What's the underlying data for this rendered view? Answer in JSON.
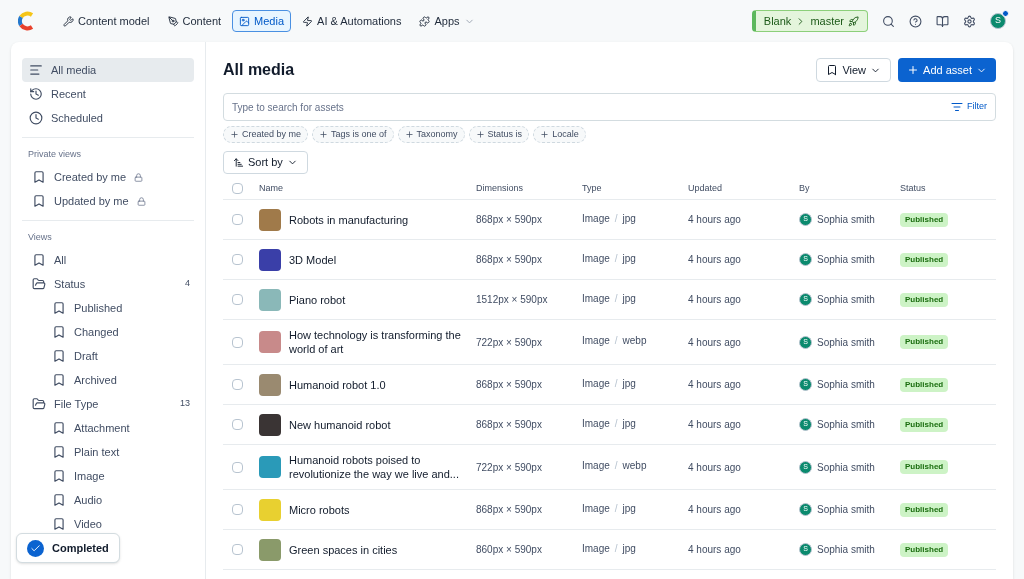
{
  "topbar": {
    "nav": [
      {
        "label": "Content model",
        "selected": false,
        "dropdown": false
      },
      {
        "label": "Content",
        "selected": false,
        "dropdown": false
      },
      {
        "label": "Media",
        "selected": true,
        "dropdown": false
      },
      {
        "label": "AI & Automations",
        "selected": false,
        "dropdown": false
      },
      {
        "label": "Apps",
        "selected": false,
        "dropdown": true
      }
    ],
    "environment": {
      "space": "Blank",
      "branch": "master"
    },
    "user": {
      "initial": "S",
      "notification": true
    }
  },
  "sidebar": {
    "top": [
      {
        "label": "All media",
        "selected": true
      },
      {
        "label": "Recent",
        "selected": false
      },
      {
        "label": "Scheduled",
        "selected": false
      }
    ],
    "sections": [
      {
        "title": "Private views",
        "items": [
          {
            "label": "Created by me",
            "locked": true,
            "selected": false
          },
          {
            "label": "Updated by me",
            "locked": true,
            "selected": false
          }
        ]
      },
      {
        "title": "Views",
        "items": [
          {
            "label": "All",
            "selected": false
          },
          {
            "label": "Status",
            "count": "4",
            "folder": true,
            "selected": false,
            "children": [
              {
                "label": "Published",
                "selected": false
              },
              {
                "label": "Changed",
                "selected": false
              },
              {
                "label": "Draft",
                "selected": false
              },
              {
                "label": "Archived",
                "selected": false
              }
            ]
          },
          {
            "label": "File Type",
            "count": "13",
            "folder": true,
            "selected": false,
            "children": [
              {
                "label": "Attachment",
                "selected": false
              },
              {
                "label": "Plain text",
                "selected": false
              },
              {
                "label": "Image",
                "selected": false
              },
              {
                "label": "Audio",
                "selected": false
              },
              {
                "label": "Video",
                "selected": false
              }
            ]
          }
        ]
      }
    ]
  },
  "toast": {
    "text": "Completed"
  },
  "main": {
    "title": "All media",
    "view_button": "View",
    "add_button": "Add asset",
    "search": {
      "placeholder": "Type to search for assets",
      "filter": "Filter"
    },
    "filter_chips": [
      "Created by me",
      "Tags is one of",
      "Taxonomy",
      "Status is",
      "Locale"
    ],
    "sort_button": "Sort by",
    "table": {
      "select_all_checked": false,
      "columns": [
        "Name",
        "Dimensions",
        "Type",
        "Updated",
        "By",
        "Status"
      ],
      "rows": [
        {
          "name": "Robots in manufacturing",
          "separator": "/",
          "dimensions": "868px × 590px",
          "type": "Image",
          "format": "jpg",
          "updated": "4 hours ago",
          "by": "Sophia smith",
          "avatar": "S",
          "status": "Published",
          "checked": false
        },
        {
          "name": "3D Model",
          "separator": "/",
          "dimensions": "868px × 590px",
          "type": "Image",
          "format": "jpg",
          "updated": "4 hours ago",
          "by": "Sophia smith",
          "avatar": "S",
          "status": "Published",
          "checked": false
        },
        {
          "name": "Piano robot",
          "separator": "/",
          "dimensions": "1512px × 590px",
          "type": "Image",
          "format": "jpg",
          "updated": "4 hours ago",
          "by": "Sophia smith",
          "avatar": "S",
          "status": "Published",
          "checked": false
        },
        {
          "name": "How technology is transforming the world of art",
          "separator": "/",
          "dimensions": "722px × 590px",
          "type": "Image",
          "format": "webp",
          "updated": "4 hours ago",
          "by": "Sophia smith",
          "avatar": "S",
          "status": "Published",
          "checked": false
        },
        {
          "name": "Humanoid robot 1.0",
          "separator": "/",
          "dimensions": "868px × 590px",
          "type": "Image",
          "format": "jpg",
          "updated": "4 hours ago",
          "by": "Sophia smith",
          "avatar": "S",
          "status": "Published",
          "checked": false
        },
        {
          "name": "New humanoid robot",
          "separator": "/",
          "dimensions": "868px × 590px",
          "type": "Image",
          "format": "jpg",
          "updated": "4 hours ago",
          "by": "Sophia smith",
          "avatar": "S",
          "status": "Published",
          "checked": false
        },
        {
          "name": "Humanoid robots poised to revolutionize the way we live and...",
          "separator": "/",
          "dimensions": "722px × 590px",
          "type": "Image",
          "format": "webp",
          "updated": "4 hours ago",
          "by": "Sophia smith",
          "avatar": "S",
          "status": "Published",
          "checked": false
        },
        {
          "name": "Micro robots",
          "separator": "/",
          "dimensions": "868px × 590px",
          "type": "Image",
          "format": "jpg",
          "updated": "4 hours ago",
          "by": "Sophia smith",
          "avatar": "S",
          "status": "Published",
          "checked": false
        },
        {
          "name": "Green spaces in cities",
          "separator": "/",
          "dimensions": "860px × 590px",
          "type": "Image",
          "format": "jpg",
          "updated": "4 hours ago",
          "by": "Sophia smith",
          "avatar": "S",
          "status": "Published",
          "checked": false
        }
      ]
    }
  }
}
